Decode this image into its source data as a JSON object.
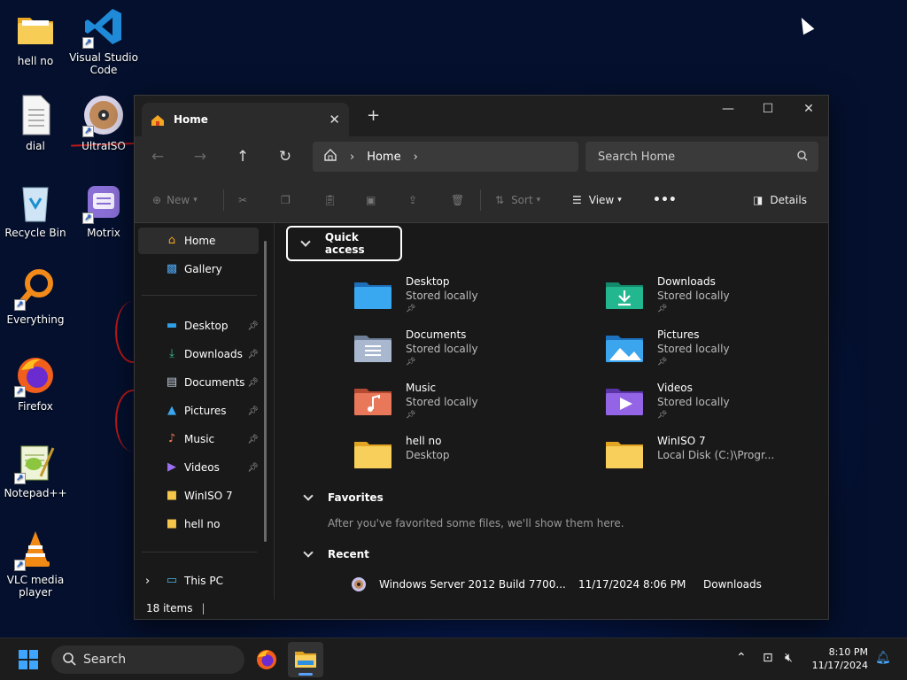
{
  "desktop": {
    "icons": [
      {
        "label": "hell no",
        "icon": "folder-icon"
      },
      {
        "label": "Visual Studio\nCode",
        "icon": "vscode-icon"
      },
      {
        "label": "dial",
        "icon": "file-icon"
      },
      {
        "label": "UltraISO",
        "icon": "ultraiso-icon"
      },
      {
        "label": "Recycle Bin",
        "icon": "recycle-bin-icon"
      },
      {
        "label": "Motrix",
        "icon": "motrix-icon"
      },
      {
        "label": "Everything",
        "icon": "everything-icon"
      },
      {
        "label": "Firefox",
        "icon": "firefox-icon"
      },
      {
        "label": "Notepad++",
        "icon": "notepadpp-icon"
      },
      {
        "label": "VLC media\nplayer",
        "icon": "vlc-icon"
      }
    ]
  },
  "explorer": {
    "tab_title": "Home",
    "address": {
      "crumb": "Home"
    },
    "search_placeholder": "Search Home",
    "toolbar": {
      "new": "New",
      "sort": "Sort",
      "view": "View",
      "more": "•••",
      "details": "Details"
    },
    "sidebar": {
      "top": [
        {
          "label": "Home",
          "icon": "home-icon",
          "selected": true
        },
        {
          "label": "Gallery",
          "icon": "gallery-icon"
        }
      ],
      "pinned": [
        {
          "label": "Desktop",
          "icon": "desktop-icon",
          "pinned": true
        },
        {
          "label": "Downloads",
          "icon": "downloads-icon",
          "pinned": true
        },
        {
          "label": "Documents",
          "icon": "documents-icon",
          "pinned": true
        },
        {
          "label": "Pictures",
          "icon": "pictures-icon",
          "pinned": true
        },
        {
          "label": "Music",
          "icon": "music-icon",
          "pinned": true
        },
        {
          "label": "Videos",
          "icon": "videos-icon",
          "pinned": true
        },
        {
          "label": "WinISO 7",
          "icon": "folder-icon",
          "pinned": false
        },
        {
          "label": "hell no",
          "icon": "folder-icon",
          "pinned": false
        }
      ],
      "this_pc": "This PC"
    },
    "quick_access": {
      "header": "Quick access",
      "items": [
        {
          "name": "Desktop",
          "sub": "Stored locally",
          "pinned": true,
          "color": "#2f95e0"
        },
        {
          "name": "Downloads",
          "sub": "Stored locally",
          "pinned": true,
          "color": "#1fb38f"
        },
        {
          "name": "Documents",
          "sub": "Stored locally",
          "pinned": true,
          "color": "#8fa3bf"
        },
        {
          "name": "Pictures",
          "sub": "Stored locally",
          "pinned": true,
          "color": "#3a9fe6"
        },
        {
          "name": "Music",
          "sub": "Stored locally",
          "pinned": true,
          "color": "#e0704a"
        },
        {
          "name": "Videos",
          "sub": "Stored locally",
          "pinned": true,
          "color": "#8e5ce0"
        },
        {
          "name": "hell no",
          "sub": "Desktop",
          "pinned": false,
          "color": "#f6c64a"
        },
        {
          "name": "WinISO 7",
          "sub": "Local Disk (C:)\\Progr...",
          "pinned": false,
          "color": "#f6c64a"
        }
      ]
    },
    "favorites": {
      "header": "Favorites",
      "note": "After you've favorited some files, we'll show them here."
    },
    "recent": {
      "header": "Recent",
      "rows": [
        {
          "name": "Windows Server 2012 Build 7700...",
          "date": "11/17/2024 8:06 PM",
          "location": "Downloads"
        }
      ]
    },
    "status": "18 items"
  },
  "taskbar": {
    "search": "Search",
    "time": "8:10 PM",
    "date": "11/17/2024"
  },
  "colors": {
    "accent": "#5aa0ff",
    "folder": "#f6c64a"
  }
}
